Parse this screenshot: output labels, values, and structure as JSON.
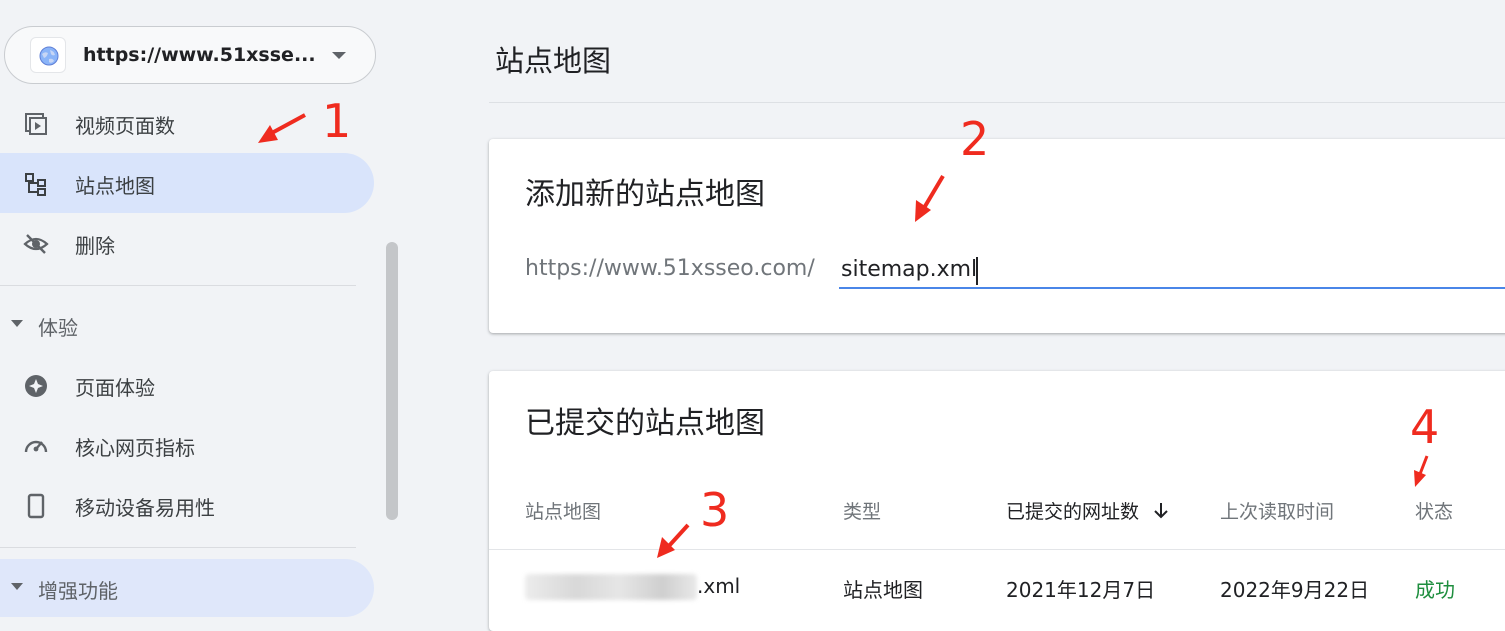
{
  "sidebar": {
    "property_url": "https://www.51xsse...",
    "items": [
      {
        "label": "视频页面数",
        "icon": "video-pages-icon"
      },
      {
        "label": "站点地图",
        "icon": "sitemap-icon",
        "selected": true
      },
      {
        "label": "删除",
        "icon": "removals-icon"
      }
    ],
    "sections": [
      {
        "label": "体验",
        "items": [
          {
            "label": "页面体验",
            "icon": "page-experience-icon"
          },
          {
            "label": "核心网页指标",
            "icon": "core-web-vitals-icon"
          },
          {
            "label": "移动设备易用性",
            "icon": "mobile-usability-icon"
          }
        ]
      },
      {
        "label": "增强功能"
      }
    ]
  },
  "main": {
    "page_title": "站点地图",
    "add_card": {
      "title": "添加新的站点地图",
      "url_prefix": "https://www.51xsseo.com/",
      "input_value": "sitemap.xml"
    },
    "list_card": {
      "title": "已提交的站点地图",
      "columns": [
        "站点地图",
        "类型",
        "已提交的网址数",
        "上次读取时间",
        "状态"
      ],
      "rows": [
        {
          "sitemap": ".xml",
          "type": "站点地图",
          "submitted": "2021年12月7日",
          "last_read": "2022年9月22日",
          "status": "成功"
        }
      ]
    }
  },
  "annotations": [
    "1",
    "2",
    "3",
    "4"
  ],
  "colors": {
    "accent": "#4a86e8",
    "selected_bg": "#d9e4fb",
    "success": "#1e8e3e",
    "annotation": "#ef2b1f"
  }
}
